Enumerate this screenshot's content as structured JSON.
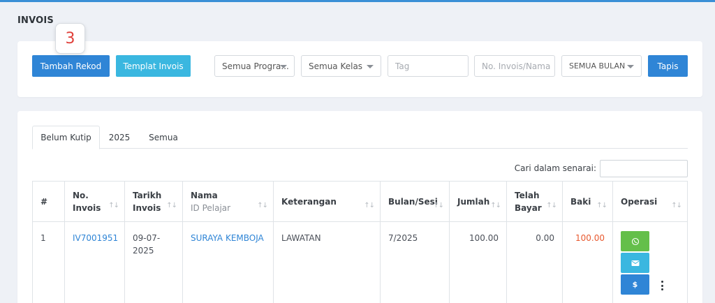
{
  "page": {
    "title": "INVOIS"
  },
  "badge": {
    "value": "3"
  },
  "toolbar": {
    "add_label": "Tambah Rekod",
    "template_label": "Templat Invois",
    "program_select": "Semua Progra...",
    "class_select": "Semua Kelas",
    "tag_placeholder": "Tag",
    "invoice_placeholder": "No. Invois/Nama",
    "month_select": "SEMUA BULAN",
    "filter_label": "Tapis"
  },
  "tabs": [
    {
      "label": "Belum Kutip",
      "active": true
    },
    {
      "label": "2025",
      "active": false
    },
    {
      "label": "Semua",
      "active": false
    }
  ],
  "search": {
    "label": "Cari dalam senarai:",
    "value": ""
  },
  "table": {
    "columns": [
      {
        "label": "#",
        "sub": ""
      },
      {
        "label": "No.",
        "sub": "Invois"
      },
      {
        "label": "Tarikh",
        "sub": "Invois"
      },
      {
        "label": "Nama",
        "sub": "ID Pelajar"
      },
      {
        "label": "Keterangan",
        "sub": ""
      },
      {
        "label": "Bulan/Sesi",
        "sub": ""
      },
      {
        "label": "Jumlah",
        "sub": ""
      },
      {
        "label": "Telah",
        "sub": "Bayar"
      },
      {
        "label": "Baki",
        "sub": ""
      },
      {
        "label": "Operasi",
        "sub": ""
      }
    ],
    "sort_glyph": "↑↓",
    "rows": [
      {
        "num": "1",
        "invoice": "IV7001951",
        "date_line1": "09-07-",
        "date_line2": "2025",
        "name": "SURAYA KEMBOJA",
        "description": "LAWATAN",
        "period": "7/2025",
        "total": "100.00",
        "paid": "0.00",
        "balance": "100.00"
      }
    ]
  },
  "operations": {
    "pay_symbol": "$"
  },
  "colors": {
    "primary": "#2f85d6",
    "info": "#3ab7e0",
    "success": "#64bf4a",
    "danger": "#e8592f"
  },
  "icons": [
    "whatsapp-icon",
    "mail-icon",
    "dollar-icon",
    "kebab-menu-icon",
    "chevron-down-icon",
    "sort-icon"
  ]
}
